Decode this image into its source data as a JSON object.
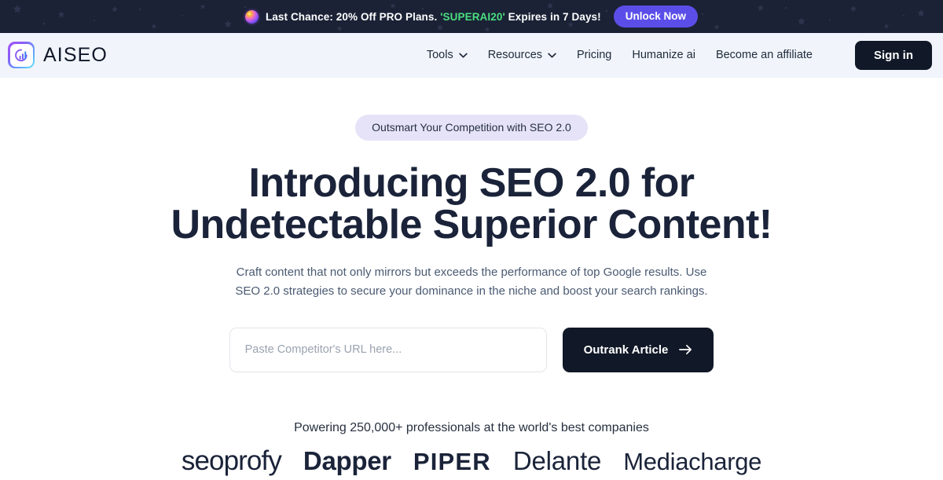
{
  "banner": {
    "orb_icon": "gradient-orb-icon",
    "text_before": "Last Chance: 20% Off PRO Plans.",
    "coupon_code": "'SUPERAI20'",
    "text_after": "Expires in 7 Days!",
    "cta_label": "Unlock Now",
    "background": "#1b2236",
    "cta_color": "#5b4ee8",
    "coupon_color": "#4ade80"
  },
  "header": {
    "brand_name": "AISEO",
    "brand_icon": "aiseo-bar-chart-logo",
    "background": "#f1f5fb",
    "nav": [
      {
        "label": "Tools",
        "has_dropdown": true
      },
      {
        "label": "Resources",
        "has_dropdown": true
      },
      {
        "label": "Pricing",
        "has_dropdown": false
      },
      {
        "label": "Humanize ai",
        "has_dropdown": false
      },
      {
        "label": "Become an affiliate",
        "has_dropdown": false
      }
    ],
    "signin_label": "Sign in"
  },
  "hero": {
    "pill_label": "Outsmart Your Competition with SEO 2.0",
    "pill_background": "#e6e3f8",
    "title_line1": "Introducing SEO 2.0 for",
    "title_line2": "Undetectable Superior Content!",
    "subtitle_line1": "Craft content that not only mirrors but exceeds the performance of top Google results. Use",
    "subtitle_line2": "SEO 2.0 strategies to secure your dominance in the niche and boost your search rankings.",
    "input_placeholder": "Paste Competitor's URL here...",
    "input_value": "",
    "cta_label": "Outrank Article",
    "cta_icon": "arrow-right-icon",
    "cta_color": "#111827"
  },
  "social_proof": {
    "heading": "Powering 250,000+ professionals at the world's best companies",
    "logos": [
      {
        "name": "seoprofy"
      },
      {
        "name": "Dapper"
      },
      {
        "name": "PIPER"
      },
      {
        "name": "Delante"
      },
      {
        "name": "Mediacharge"
      }
    ]
  }
}
